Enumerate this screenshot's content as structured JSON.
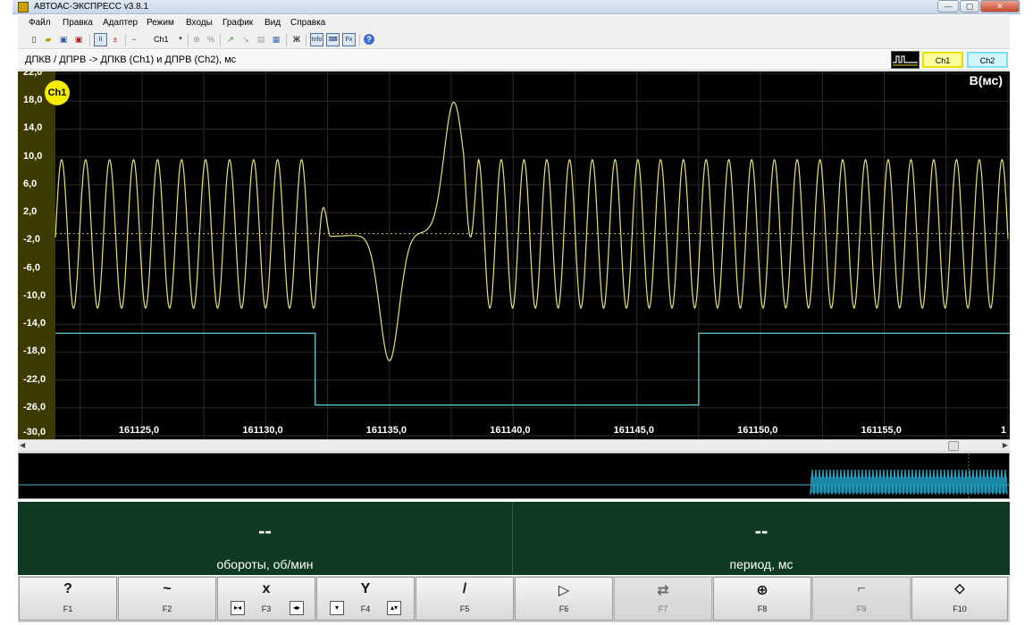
{
  "window": {
    "title": "АВТОАС-ЭКСПРЕСС v3.8.1",
    "buttons": {
      "minimize": "—",
      "maximize": "▢",
      "close": "✕"
    }
  },
  "menu": [
    "Файл",
    "Правка",
    "Адаптер",
    "Режим",
    "Входы",
    "График",
    "Вид",
    "Справка"
  ],
  "toolbar": {
    "channel_select": "Ch1",
    "info_label": "Info",
    "fx_label": "Fx",
    "bold_label": "Ж"
  },
  "header": {
    "caption": "ДПКВ / ДПРВ -> ДПКВ (Ch1) и ДПРВ (Ch2), мс",
    "tab_ch1": "Ch1",
    "tab_ch2": "Ch2"
  },
  "plot": {
    "badge": "Ch1",
    "unit": "В(мс)"
  },
  "chart_data": {
    "type": "line",
    "xlabel": "",
    "ylabel": "В(мс)",
    "x_range": [
      161121.5,
      161160.0
    ],
    "ylim": [
      -30.0,
      22.0
    ],
    "y_ticks": [
      "22,0",
      "18,0",
      "14,0",
      "10,0",
      "6,0",
      "2,0",
      "-2,0",
      "-6,0",
      "-10,0",
      "-14,0",
      "-18,0",
      "-22,0",
      "-26,0",
      "-30,0"
    ],
    "x_ticks": [
      "161125,0",
      "161130,0",
      "161135,0",
      "161140,0",
      "161145,0",
      "161150,0",
      "161155,0",
      "1"
    ],
    "grid": true,
    "series": [
      {
        "name": "Ch1",
        "color": "#e6e07a",
        "description_values": {
          "baseline": -1.0,
          "low_amplitude_peaks": [
            9.6,
            -11.7
          ],
          "gap_start_peak": -19.2,
          "gap_end_peak": 17.5
        }
      },
      {
        "name": "Ch2",
        "color": "#5fd3d3",
        "levels": {
          "high": -15.3,
          "low": -25.6
        },
        "low_interval": [
          161132.0,
          161147.5
        ]
      }
    ]
  },
  "readouts": [
    {
      "value": "--",
      "label": "обороты, об/мин"
    },
    {
      "value": "--",
      "label": "период, мс"
    }
  ],
  "fkeys": [
    {
      "label": "F1",
      "icon": "?"
    },
    {
      "label": "F2",
      "icon": "~"
    },
    {
      "label": "F3",
      "icon": "x"
    },
    {
      "label": "F4",
      "icon": "Y"
    },
    {
      "label": "F5",
      "icon": "/"
    },
    {
      "label": "F6",
      "icon": "▷"
    },
    {
      "label": "F7",
      "icon": "⇄"
    },
    {
      "label": "F8",
      "icon": "⊕"
    },
    {
      "label": "F9",
      "icon": "⌐"
    },
    {
      "label": "F10",
      "icon": "⬦"
    }
  ]
}
